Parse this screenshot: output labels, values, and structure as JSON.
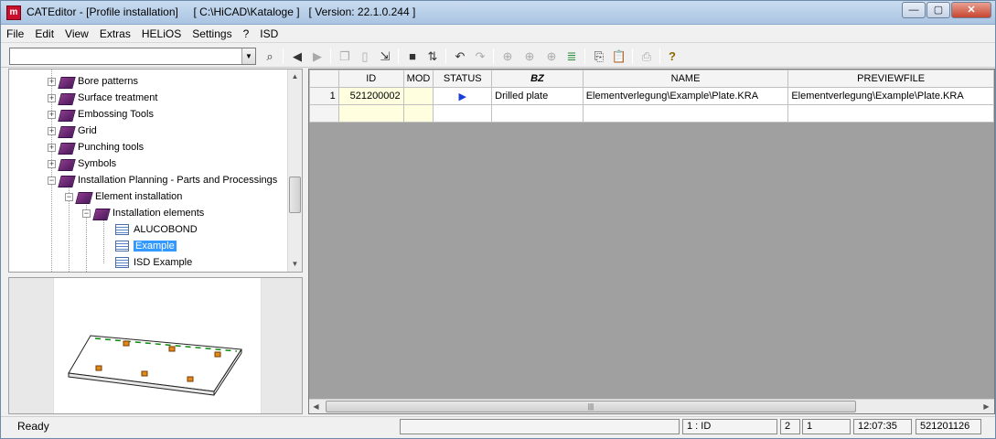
{
  "window": {
    "title": "CATEditor - [Profile installation]     [ C:\\HiCAD\\Kataloge ]   [ Version: 22.1.0.244 ]",
    "app_icon_text": "m",
    "buttons": {
      "minimize": "—",
      "maximize": "▢",
      "close": "✕"
    }
  },
  "menu": [
    "File",
    "Edit",
    "View",
    "Extras",
    "HELiOS",
    "Settings",
    "?",
    "ISD"
  ],
  "toolbar": {
    "combo_value": "",
    "icons": [
      "binoculars-icon",
      "back-icon",
      "forward-icon",
      "copy-doc-icon",
      "new-doc-icon",
      "doc-link-icon",
      "save-icon",
      "sort-icon",
      "undo-icon",
      "redo-icon",
      "add-row-icon",
      "add-column-icon",
      "add-item-icon",
      "database-icon",
      "copy-icon",
      "paste-icon",
      "print-icon",
      "help-icon"
    ]
  },
  "tree": {
    "items": [
      {
        "label": "Bore patterns",
        "level": 0,
        "kind": "book",
        "expander": "+"
      },
      {
        "label": "Surface treatment",
        "level": 0,
        "kind": "book",
        "expander": "+"
      },
      {
        "label": "Embossing Tools",
        "level": 0,
        "kind": "book",
        "expander": "+"
      },
      {
        "label": "Grid",
        "level": 0,
        "kind": "book",
        "expander": "+"
      },
      {
        "label": "Punching tools",
        "level": 0,
        "kind": "book",
        "expander": "+"
      },
      {
        "label": "Symbols",
        "level": 0,
        "kind": "book",
        "expander": "+"
      },
      {
        "label": "Installation Planning - Parts and Processings",
        "level": 0,
        "kind": "book",
        "expander": "−"
      },
      {
        "label": "Element installation",
        "level": 1,
        "kind": "book",
        "expander": "−"
      },
      {
        "label": "Installation elements",
        "level": 2,
        "kind": "book",
        "expander": "−"
      },
      {
        "label": "ALUCOBOND",
        "level": 3,
        "kind": "table",
        "expander": ""
      },
      {
        "label": "Example",
        "level": 3,
        "kind": "table",
        "expander": "",
        "selected": true
      },
      {
        "label": "ISD Example",
        "level": 3,
        "kind": "table",
        "expander": ""
      }
    ]
  },
  "grid": {
    "columns": [
      "",
      "ID",
      "MOD",
      "STATUS",
      "BZ",
      "NAME",
      "PREVIEWFILE"
    ],
    "rows": [
      {
        "num": "1",
        "id": "521200002",
        "mod": "",
        "status": "▶",
        "bz": "Drilled plate",
        "name": "Elementverlegung\\Example\\Plate.KRA",
        "previewfile": "Elementverlegung\\Example\\Plate.KRA"
      },
      {
        "num": "",
        "id": "",
        "mod": "",
        "status": "",
        "bz": "",
        "name": "",
        "previewfile": ""
      }
    ]
  },
  "statusbar": {
    "ready": "Ready",
    "cell": "1 : ID",
    "count": "2",
    "row": "1",
    "time": "12:07:35",
    "date": "521201126"
  },
  "colors": {
    "selection": "#3399ff",
    "grid_bg": "#a0a0a0",
    "mod_column": "#ffffe0",
    "status_arrow": "#1a3fd8"
  }
}
